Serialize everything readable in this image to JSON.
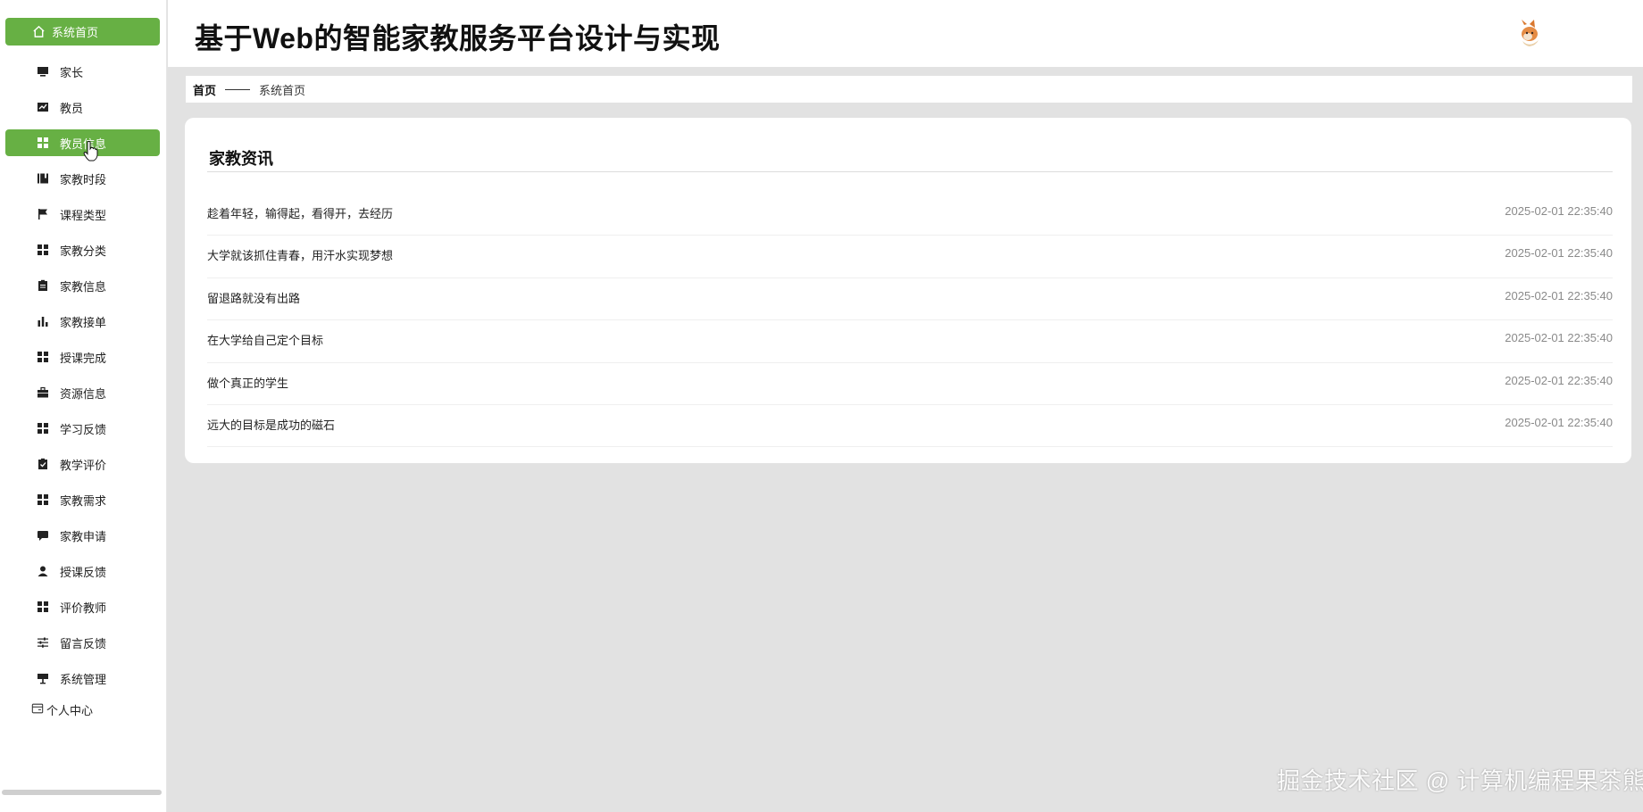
{
  "app": {
    "title": "基于Web的智能家教服务平台设计与实现"
  },
  "sidebar": {
    "home_label": "系统首页",
    "items": [
      {
        "label": "家长",
        "icon": "monitor-icon"
      },
      {
        "label": "教员",
        "icon": "chart-line-icon"
      },
      {
        "label": "教员信息",
        "icon": "grid-icon",
        "active": true
      },
      {
        "label": "家教时段",
        "icon": "book-icon"
      },
      {
        "label": "课程类型",
        "icon": "flag-icon"
      },
      {
        "label": "家教分类",
        "icon": "grid-icon"
      },
      {
        "label": "家教信息",
        "icon": "clipboard-icon"
      },
      {
        "label": "家教接单",
        "icon": "bar-chart-icon"
      },
      {
        "label": "授课完成",
        "icon": "grid-icon"
      },
      {
        "label": "资源信息",
        "icon": "briefcase-icon"
      },
      {
        "label": "学习反馈",
        "icon": "grid-icon"
      },
      {
        "label": "教学评价",
        "icon": "clipboard-check-icon"
      },
      {
        "label": "家教需求",
        "icon": "grid-icon"
      },
      {
        "label": "家教申请",
        "icon": "chat-icon"
      },
      {
        "label": "授课反馈",
        "icon": "user-icon"
      },
      {
        "label": "评价教师",
        "icon": "grid-icon"
      },
      {
        "label": "留言反馈",
        "icon": "sliders-icon"
      },
      {
        "label": "系统管理",
        "icon": "sign-icon"
      }
    ],
    "personal_label": "个人中心"
  },
  "breadcrumb": {
    "home": "首页",
    "current": "系统首页"
  },
  "news": {
    "title": "家教资讯",
    "items": [
      {
        "title": "趁着年轻，输得起，看得开，去经历",
        "time": "2025-02-01 22:35:40"
      },
      {
        "title": "大学就该抓住青春，用汗水实现梦想",
        "time": "2025-02-01 22:35:40"
      },
      {
        "title": "留退路就没有出路",
        "time": "2025-02-01 22:35:40"
      },
      {
        "title": "在大学给自己定个目标",
        "time": "2025-02-01 22:35:40"
      },
      {
        "title": "做个真正的学生",
        "time": "2025-02-01 22:35:40"
      },
      {
        "title": "远大的目标是成功的磁石",
        "time": "2025-02-01 22:35:40"
      }
    ]
  },
  "watermark": "掘金技术社区 @ 计算机编程果茶熊",
  "colors": {
    "accent": "#67b044",
    "background": "#e2e2e2",
    "panel": "#ffffff"
  }
}
